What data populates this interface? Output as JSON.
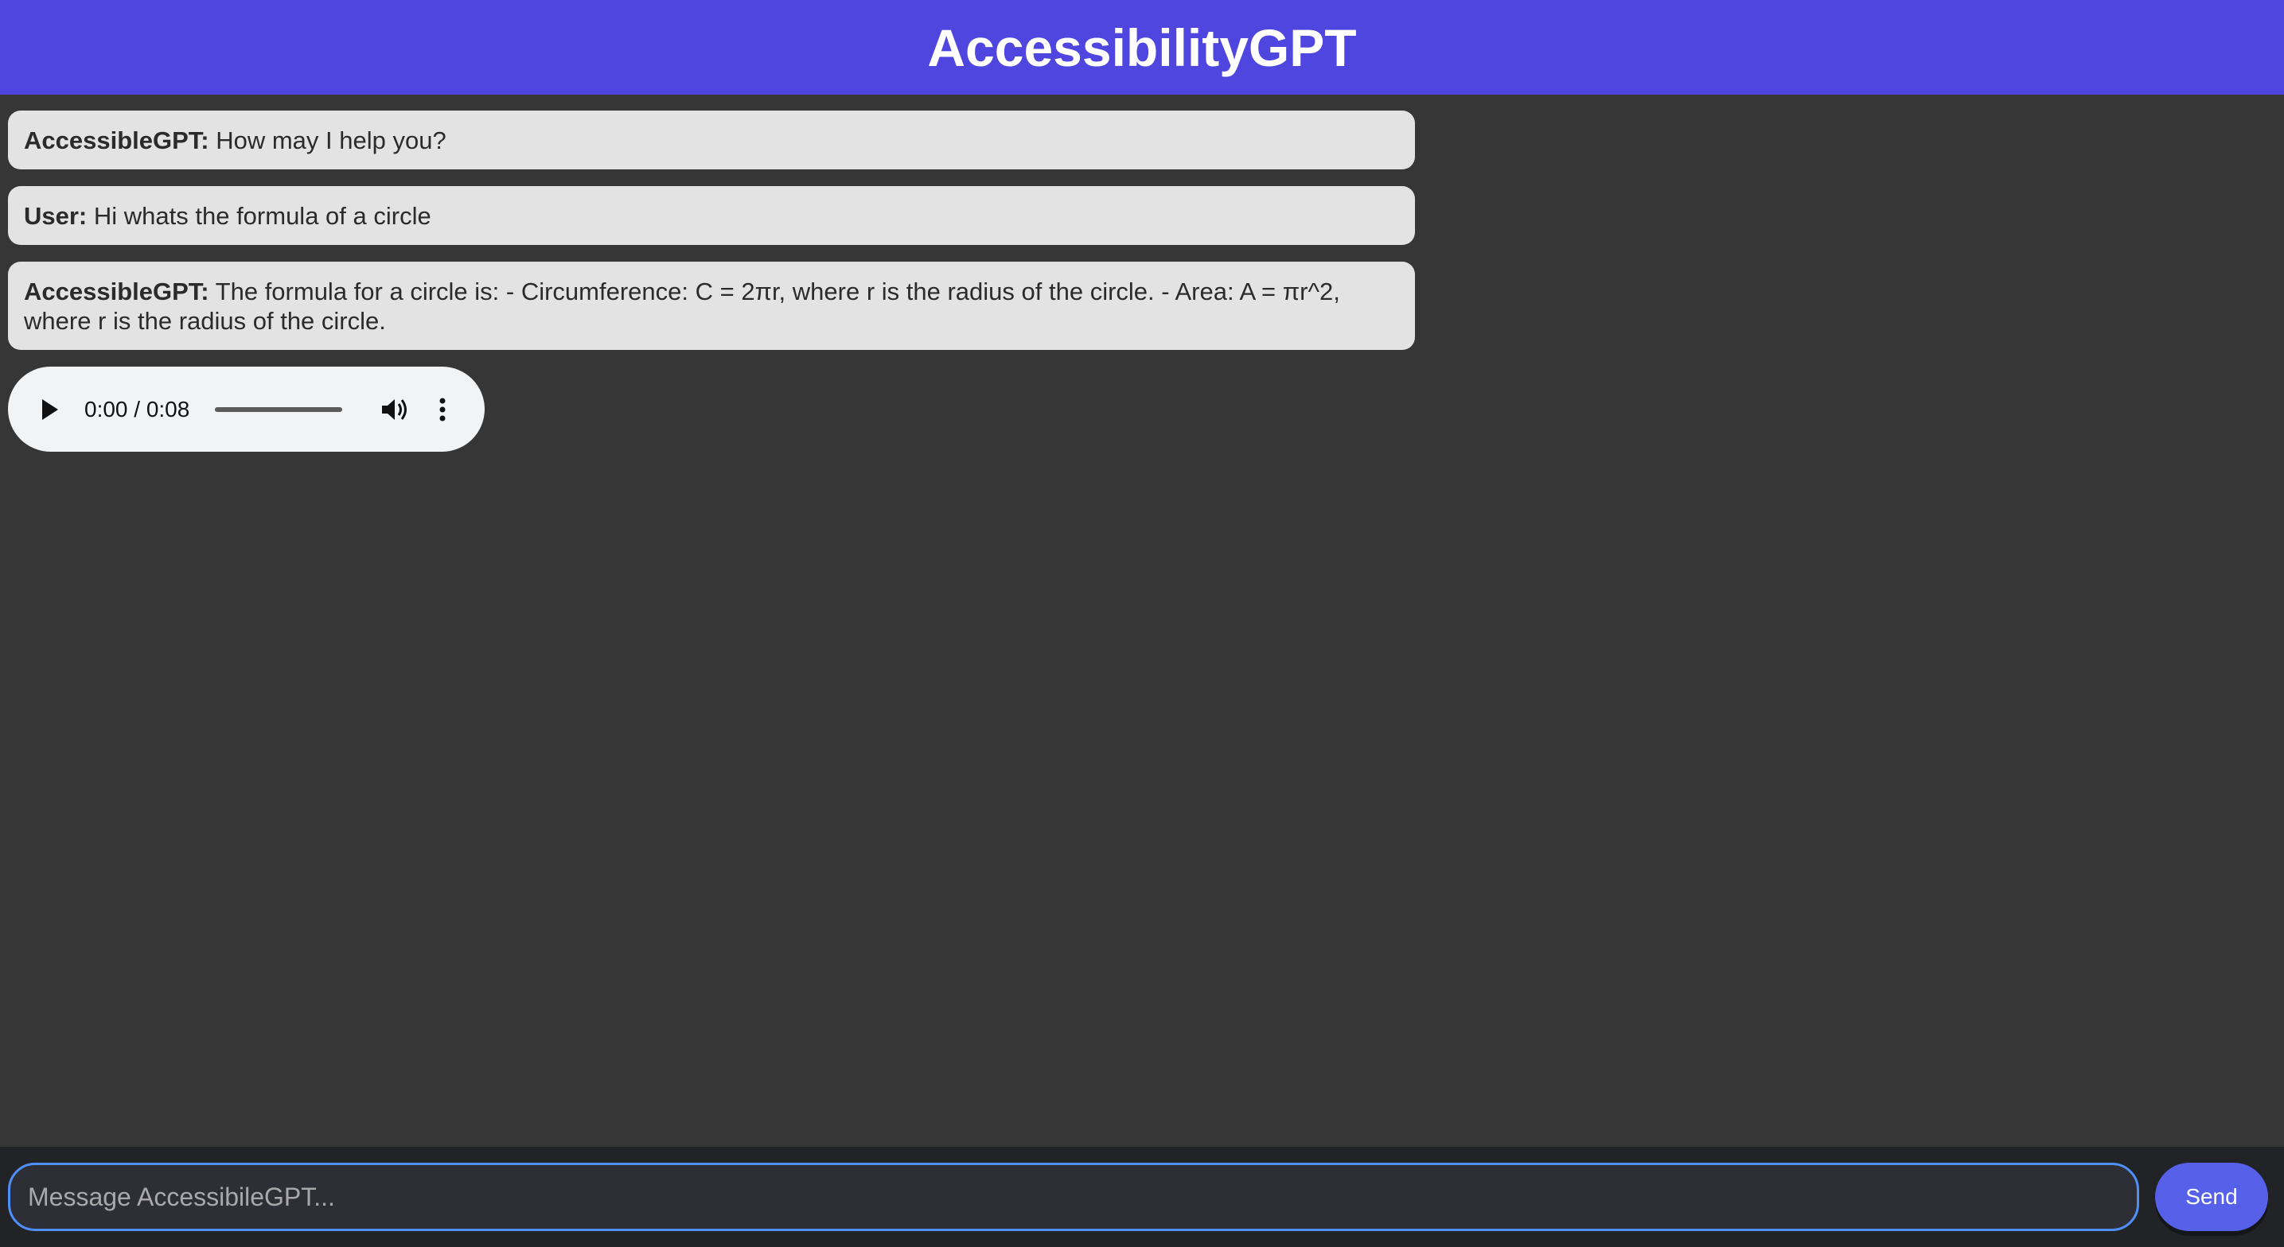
{
  "header": {
    "title": "AccessibilityGPT"
  },
  "messages": [
    {
      "sender": "AccessibleGPT:",
      "text": " How may I help you?"
    },
    {
      "sender": "User:",
      "text": " Hi whats the formula of a circle"
    },
    {
      "sender": "AccessibleGPT:",
      "text": " The formula for a circle is: - Circumference: C = 2πr, where r is the radius of the circle. - Area: A = πr^2, where r is the radius of the circle."
    }
  ],
  "audio": {
    "time": "0:00 / 0:08",
    "play_icon": "play-icon",
    "volume_icon": "volume-icon",
    "more_icon": "more-vertical-icon"
  },
  "composer": {
    "placeholder": "Message AccessibileGPT...",
    "value": "",
    "send_label": "Send"
  },
  "colors": {
    "header_bg": "#4f46e0",
    "page_bg": "#363636",
    "bubble_bg": "#e3e3e3",
    "send_bg": "#5660e8",
    "input_border": "#4f8ff7"
  }
}
